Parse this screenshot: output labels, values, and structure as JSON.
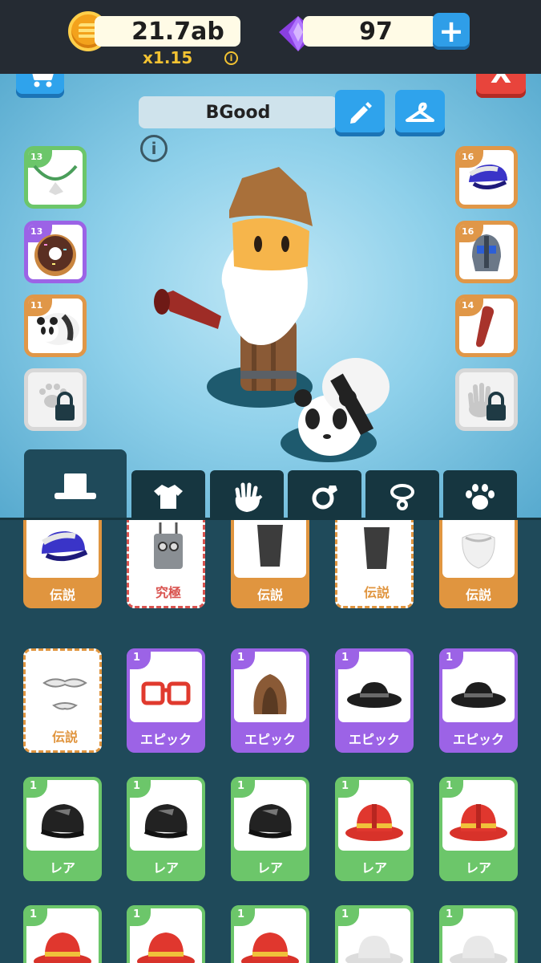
{
  "currency": {
    "coins": "21.7ab",
    "multiplier": "x1.15",
    "gems": "97",
    "info_glyph": "i",
    "plus_glyph": "+"
  },
  "header": {
    "player_name": "BGood",
    "close_label": "X",
    "info_glyph": "i"
  },
  "colors": {
    "legend": "#e0953f",
    "ultimate": "#d9534f",
    "epic": "#9c63e6",
    "rare": "#6cc66a",
    "panel": "#1f4a5a"
  },
  "left_slots": [
    {
      "level": "13",
      "rarity": "rare",
      "item": "necklace-icon"
    },
    {
      "level": "13",
      "rarity": "epic",
      "item": "donut-icon"
    },
    {
      "level": "11",
      "rarity": "legend",
      "item": "panda-icon"
    },
    {
      "level": "",
      "rarity": "locked",
      "item": "paw-lock-icon"
    }
  ],
  "right_slots": [
    {
      "level": "16",
      "rarity": "legend",
      "item": "cap-icon"
    },
    {
      "level": "16",
      "rarity": "legend",
      "item": "helmet-icon"
    },
    {
      "level": "14",
      "rarity": "legend",
      "item": "bat-icon"
    },
    {
      "level": "",
      "rarity": "locked",
      "item": "hand-lock-icon"
    }
  ],
  "tabs": [
    "hat-icon",
    "shirt-icon",
    "hand-icon",
    "ring-icon",
    "necklace-icon",
    "paw-icon"
  ],
  "grid": [
    [
      {
        "label": "伝説",
        "style": "orange",
        "level": "",
        "item": "cap-icon"
      },
      {
        "label": "究極",
        "style": "red-dash",
        "level": "",
        "item": "robot-head-icon"
      },
      {
        "label": "伝説",
        "style": "orange",
        "level": "",
        "item": "top-hat-icon"
      },
      {
        "label": "伝説",
        "style": "orange-dash",
        "level": "",
        "item": "top-hat-icon"
      },
      {
        "label": "伝説",
        "style": "orange",
        "level": "",
        "item": "beard-icon"
      }
    ],
    [
      {
        "label": "伝説",
        "style": "orange-dash",
        "level": "",
        "item": "mustache-icon"
      },
      {
        "label": "エピック",
        "style": "purple",
        "level": "1",
        "item": "goggles-icon"
      },
      {
        "label": "エピック",
        "style": "purple",
        "level": "1",
        "item": "hood-icon"
      },
      {
        "label": "エピック",
        "style": "purple",
        "level": "1",
        "item": "bowler-hat-icon"
      },
      {
        "label": "エピック",
        "style": "purple",
        "level": "1",
        "item": "bowler-hat-icon"
      }
    ],
    [
      {
        "label": "レア",
        "style": "green",
        "level": "1",
        "item": "beanie-icon"
      },
      {
        "label": "レア",
        "style": "green",
        "level": "1",
        "item": "beanie-icon"
      },
      {
        "label": "レア",
        "style": "green",
        "level": "1",
        "item": "beanie-icon"
      },
      {
        "label": "レア",
        "style": "green",
        "level": "1",
        "item": "fire-helmet-icon"
      },
      {
        "label": "レア",
        "style": "green",
        "level": "1",
        "item": "fire-helmet-icon"
      }
    ],
    [
      {
        "label": "",
        "style": "green",
        "level": "1",
        "item": "fire-helmet-icon"
      },
      {
        "label": "",
        "style": "green",
        "level": "1",
        "item": "fire-helmet-icon"
      },
      {
        "label": "",
        "style": "green",
        "level": "1",
        "item": "fire-helmet-icon"
      },
      {
        "label": "",
        "style": "green",
        "level": "1",
        "item": "sun-hat-icon"
      },
      {
        "label": "",
        "style": "green",
        "level": "1",
        "item": "sun-hat-icon"
      }
    ]
  ]
}
